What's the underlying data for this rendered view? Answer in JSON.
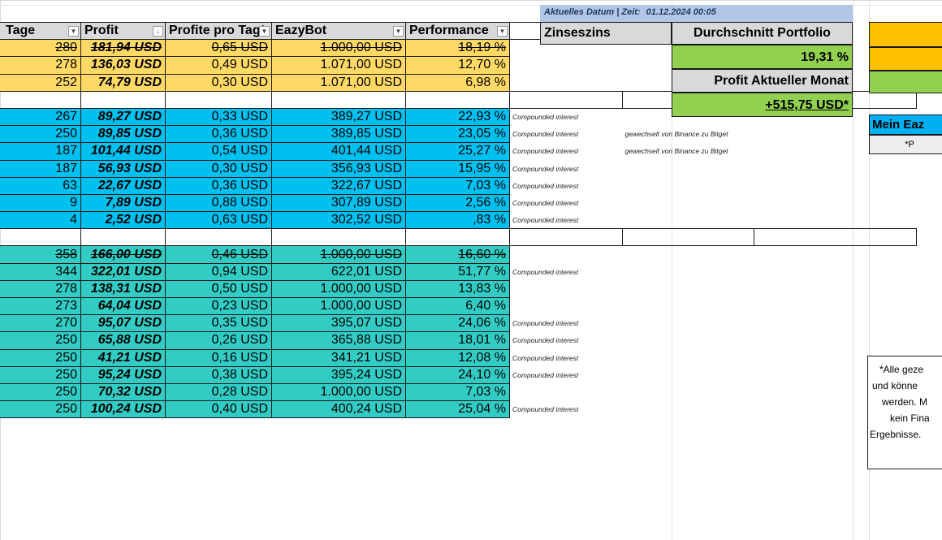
{
  "header": {
    "date_label": "Aktuelles Datum | Zeit:",
    "date_value": "01.12.2024 00:05",
    "columns": [
      "Tage",
      "Profit",
      "Profite pro Tag*",
      "EazyBot",
      "Performance",
      "Zinseszins"
    ]
  },
  "summary": {
    "avg_label": "Durchschnitt Portfolio",
    "avg_value": "19,31 %",
    "month_label": "Profit Aktueller Monat",
    "month_value": "+515,75 USD*"
  },
  "side": {
    "mein_label": "Mein Eaz",
    "mein_sub": "*P",
    "disclaimer_lines": [
      "*Alle geze",
      "und könne",
      "werden. M",
      "kein Fina",
      "Ergebnisse."
    ]
  },
  "groups": [
    {
      "color": "yellow",
      "rows": [
        {
          "tage": "280",
          "profit": "181,94 USD",
          "ppt": "0,65 USD",
          "bot": "1.000,00 USD",
          "perf": "18,19 %",
          "zins": "",
          "note": "",
          "strike": true
        },
        {
          "tage": "278",
          "profit": "136,03 USD",
          "ppt": "0,49 USD",
          "bot": "1.071,00 USD",
          "perf": "12,70 %",
          "zins": "",
          "note": "",
          "strike": false
        },
        {
          "tage": "252",
          "profit": "74,79 USD",
          "ppt": "0,30 USD",
          "bot": "1.071,00 USD",
          "perf": "6,98 %",
          "zins": "",
          "note": "",
          "strike": false
        }
      ]
    },
    {
      "color": "blue",
      "rows": [
        {
          "tage": "267",
          "profit": "89,27 USD",
          "ppt": "0,33 USD",
          "bot": "389,27 USD",
          "perf": "22,93 %",
          "zins": "Compounded interest",
          "note": "",
          "strike": false
        },
        {
          "tage": "250",
          "profit": "89,85 USD",
          "ppt": "0,36 USD",
          "bot": "389,85 USD",
          "perf": "23,05 %",
          "zins": "Compounded interest",
          "note": "gewechselt von Binance zu Bitget",
          "strike": false
        },
        {
          "tage": "187",
          "profit": "101,44 USD",
          "ppt": "0,54 USD",
          "bot": "401,44 USD",
          "perf": "25,27 %",
          "zins": "Compounded interest",
          "note": "gewechselt von Binance zu Bitget",
          "strike": false
        },
        {
          "tage": "187",
          "profit": "56,93 USD",
          "ppt": "0,30 USD",
          "bot": "356,93 USD",
          "perf": "15,95 %",
          "zins": "Compounded interest",
          "note": "",
          "strike": false
        },
        {
          "tage": "63",
          "profit": "22,67 USD",
          "ppt": "0,36 USD",
          "bot": "322,67 USD",
          "perf": "7,03 %",
          "zins": "Compounded interest",
          "note": "",
          "strike": false
        },
        {
          "tage": "9",
          "profit": "7,89 USD",
          "ppt": "0,88 USD",
          "bot": "307,89 USD",
          "perf": "2,56 %",
          "zins": "Compounded interest",
          "note": "",
          "strike": false
        },
        {
          "tage": "4",
          "profit": "2,52 USD",
          "ppt": "0,63 USD",
          "bot": "302,52 USD",
          "perf": ",83 %",
          "zins": "Compounded interest",
          "note": "",
          "strike": false
        }
      ]
    },
    {
      "color": "teal",
      "rows": [
        {
          "tage": "358",
          "profit": "166,00 USD",
          "ppt": "0,46 USD",
          "bot": "1.000,00 USD",
          "perf": "16,60 %",
          "zins": "",
          "note": "",
          "strike": true
        },
        {
          "tage": "344",
          "profit": "322,01 USD",
          "ppt": "0,94 USD",
          "bot": "622,01 USD",
          "perf": "51,77 %",
          "zins": "Compounded interest",
          "note": "",
          "strike": false
        },
        {
          "tage": "278",
          "profit": "138,31 USD",
          "ppt": "0,50 USD",
          "bot": "1.000,00 USD",
          "perf": "13,83 %",
          "zins": "",
          "note": "",
          "strike": false
        },
        {
          "tage": "273",
          "profit": "64,04 USD",
          "ppt": "0,23 USD",
          "bot": "1.000,00 USD",
          "perf": "6,40 %",
          "zins": "",
          "note": "",
          "strike": false
        },
        {
          "tage": "270",
          "profit": "95,07 USD",
          "ppt": "0,35 USD",
          "bot": "395,07 USD",
          "perf": "24,06 %",
          "zins": "Compounded interest",
          "note": "",
          "strike": false
        },
        {
          "tage": "250",
          "profit": "65,88 USD",
          "ppt": "0,26 USD",
          "bot": "365,88 USD",
          "perf": "18,01 %",
          "zins": "Compounded interest",
          "note": "",
          "strike": false
        },
        {
          "tage": "250",
          "profit": "41,21 USD",
          "ppt": "0,16 USD",
          "bot": "341,21 USD",
          "perf": "12,08 %",
          "zins": "Compounded interest",
          "note": "",
          "strike": false
        },
        {
          "tage": "250",
          "profit": "95,24 USD",
          "ppt": "0,38 USD",
          "bot": "395,24 USD",
          "perf": "24,10 %",
          "zins": "Compounded interest",
          "note": "",
          "strike": false
        },
        {
          "tage": "250",
          "profit": "70,32 USD",
          "ppt": "0,28 USD",
          "bot": "1.000,00 USD",
          "perf": "7,03 %",
          "zins": "",
          "note": "",
          "strike": false
        },
        {
          "tage": "250",
          "profit": "100,24 USD",
          "ppt": "0,40 USD",
          "bot": "400,24 USD",
          "perf": "25,04 %",
          "zins": "Compounded interest",
          "note": "",
          "strike": false
        }
      ]
    }
  ]
}
